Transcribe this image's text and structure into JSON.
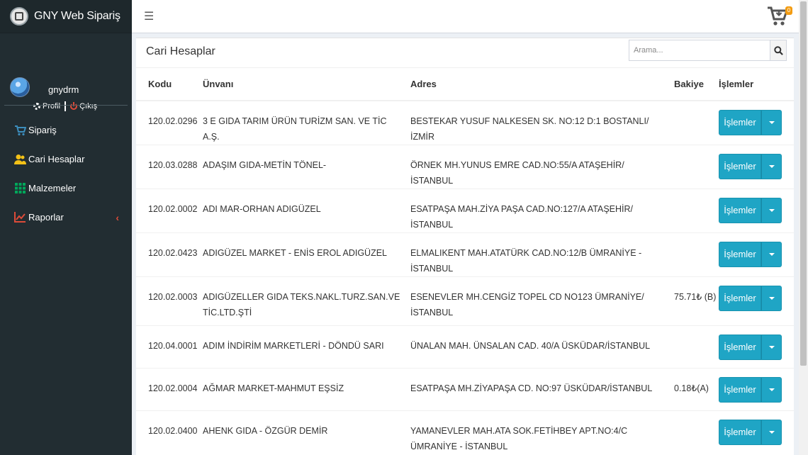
{
  "app": {
    "title": "GNY Web Sipariş"
  },
  "user": {
    "name": "gnydrm",
    "profile_label": "Profil",
    "logout_label": "Çıkış"
  },
  "menu": [
    {
      "label": "Sipariş",
      "icon": "cart-icon"
    },
    {
      "label": "Cari Hesaplar",
      "icon": "users-icon"
    },
    {
      "label": "Malzemeler",
      "icon": "grid-icon"
    },
    {
      "label": "Raporlar",
      "icon": "chart-icon"
    }
  ],
  "header": {
    "menu_toggle": "☰",
    "cart_count": "0"
  },
  "page": {
    "title": "Cari Hesaplar",
    "search_placeholder": "Arama..."
  },
  "table": {
    "columns": [
      "Kodu",
      "Ünvanı",
      "Adres",
      "Bakiye",
      "İşlemler"
    ],
    "action_label": "İşlemler",
    "rows": [
      {
        "kod": "120.02.0296",
        "unvan": "3 E GIDA TARIM ÜRÜN TURİZM SAN. VE TİC A.Ş.",
        "adres": "BESTEKAR YUSUF NALKESEN SK. NO:12 D:1 BOSTANLI/İZMİR",
        "bakiye": ""
      },
      {
        "kod": "120.03.0288",
        "unvan": "ADAŞIM GIDA-METİN TÖNEL-",
        "adres": "ÖRNEK MH.YUNUS EMRE CAD.NO:55/A ATAŞEHİR/İSTANBUL",
        "bakiye": ""
      },
      {
        "kod": "120.02.0002",
        "unvan": "ADI MAR-ORHAN ADIGÜZEL",
        "adres": "ESATPAŞA MAH.ZİYA PAŞA CAD.NO:127/A ATAŞEHİR/İSTANBUL",
        "bakiye": ""
      },
      {
        "kod": "120.02.0423",
        "unvan": "ADIGÜZEL MARKET - ENİS EROL ADIGÜZEL",
        "adres": "ELMALIKENT MAH.ATATÜRK CAD.NO:12/B ÜMRANİYE - İSTANBUL",
        "bakiye": ""
      },
      {
        "kod": "120.02.0003",
        "unvan": "ADIGÜZELLER GIDA TEKS.NAKL.TURZ.SAN.VE TİC.LTD.ŞTİ",
        "adres": "ESENEVLER MH.CENGİZ TOPEL CD NO123 ÜMRANİYE/İSTANBUL",
        "bakiye": "75.71₺ (B)"
      },
      {
        "kod": "120.04.0001",
        "unvan": "ADIM İNDİRİM MARKETLERİ - DÖNDÜ SARI",
        "adres": "ÜNALAN MAH. ÜNSALAN CAD. 40/A ÜSKÜDAR/İSTANBUL",
        "bakiye": ""
      },
      {
        "kod": "120.02.0004",
        "unvan": "AĞMAR MARKET-MAHMUT EŞSİZ",
        "adres": "ESATPAŞA MH.ZİYAPAŞA CD. NO:97 ÜSKÜDAR/İSTANBUL",
        "bakiye": "0.18₺(A)"
      },
      {
        "kod": "120.02.0400",
        "unvan": "AHENK GIDA - ÖZGÜR DEMİR",
        "adres": "YAMANEVLER MAH.ATA SOK.FETİHBEY APT.NO:4/C ÜMRANİYE - İSTANBUL",
        "bakiye": ""
      }
    ]
  },
  "colors": {
    "sidebar_bg": "#222d32",
    "accent": "#1fa5c5",
    "logout": "#dd4b39",
    "badge": "#f39c12"
  }
}
